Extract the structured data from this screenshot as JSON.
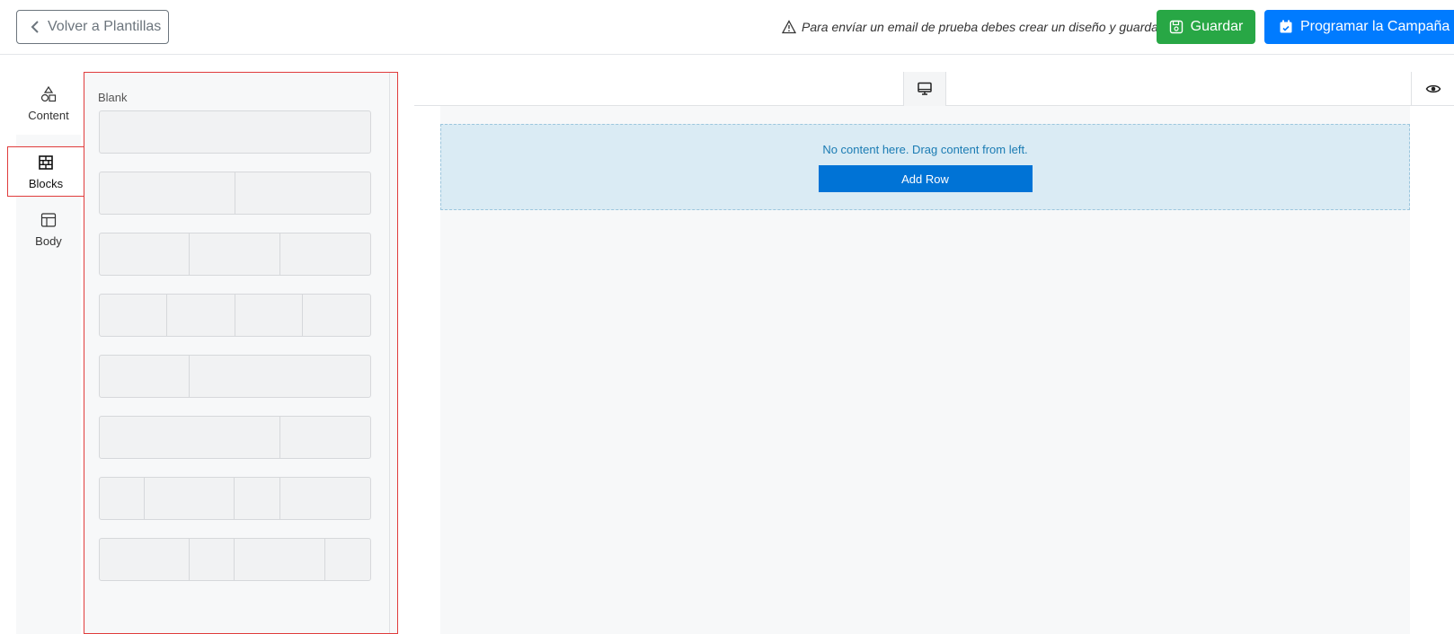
{
  "header": {
    "back_label": "Volver a Plantillas",
    "notice_text": "Para envíar un email de prueba debes crear un diseño y guardar.",
    "save_label": "Guardar",
    "schedule_label": "Programar la Campaña"
  },
  "colors": {
    "save": "#28a745",
    "schedule": "#007bff",
    "add_row": "#0073d6",
    "highlight": "#e03c3c",
    "dropzone": "#daebf4"
  },
  "tabs": {
    "content": "Content",
    "blocks": "Blocks",
    "body": "Body"
  },
  "blocks_panel": {
    "section_label": "Blank",
    "rows": [
      [
        1
      ],
      [
        1,
        1
      ],
      [
        1,
        1,
        1
      ],
      [
        1,
        1,
        1,
        1
      ],
      [
        1,
        2
      ],
      [
        2,
        1
      ],
      [
        1,
        2,
        1,
        2
      ],
      [
        2,
        1,
        2,
        1
      ]
    ]
  },
  "canvas": {
    "empty_message": "No content here. Drag content from left.",
    "add_row_label": "Add Row",
    "icons": {
      "device": "desktop-icon",
      "preview": "eye-icon"
    }
  }
}
